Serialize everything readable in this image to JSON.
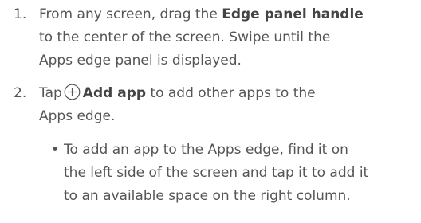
{
  "steps": [
    {
      "number": "1.",
      "line1_prefix": "From any screen, drag the ",
      "line1_bold": "Edge panel handle",
      "line2": "to the center of the screen. Swipe until the",
      "line3": "Apps edge panel is displayed."
    },
    {
      "number": "2.",
      "line1_prefix": "Tap",
      "icon": "plus-circle-icon",
      "line1_bold": "Add app",
      "line1_suffix": " to add other apps to the",
      "line2": "Apps edge."
    }
  ],
  "bullet": {
    "symbol": "•",
    "lines": [
      "To add an app to the Apps edge, find it on",
      "the left side of the screen and tap it to add it",
      "to an available space on the right column."
    ]
  }
}
